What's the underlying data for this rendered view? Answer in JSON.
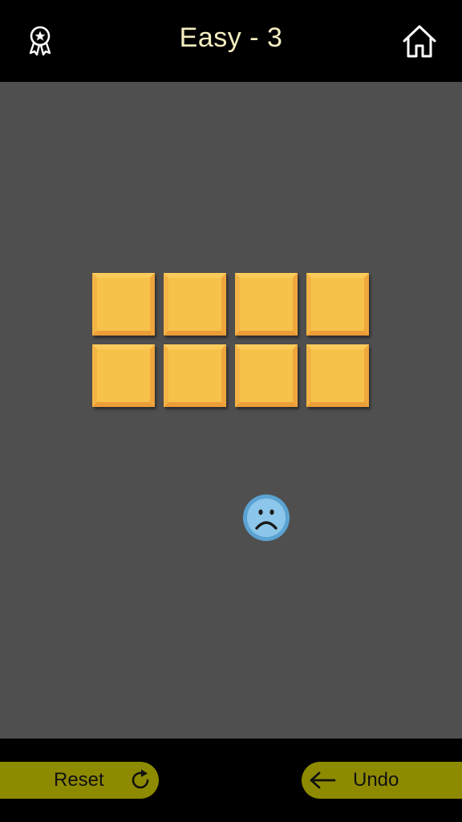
{
  "header": {
    "title": "Easy - 3",
    "left_icon": "award-ribbon-icon",
    "right_icon": "home-icon"
  },
  "board": {
    "rows": 2,
    "columns": 4,
    "tile_color": "#F7C24A",
    "background_color": "#4F4F4F"
  },
  "status": {
    "face": "sad-face-icon",
    "face_color": "#8DC6EB"
  },
  "footer": {
    "reset_label": "Reset",
    "reset_icon": "refresh-icon",
    "undo_label": "Undo",
    "undo_icon": "arrow-left-icon",
    "button_color": "#8E8A00"
  }
}
